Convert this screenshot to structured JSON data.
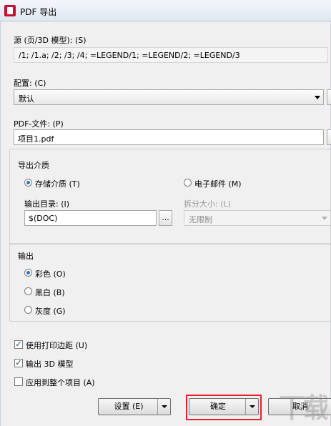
{
  "window": {
    "title": "PDF 导出"
  },
  "source": {
    "label": "源 (页/3D 模型): (S)",
    "value": "/1; /1.a; /2; /3; /4; =LEGEND/1; =LEGEND/2; =LEGEND/3"
  },
  "config": {
    "label": "配置: (C)",
    "value": "默认"
  },
  "pdf_file": {
    "label": "PDF-文件: (P)",
    "value": "项目1.pdf"
  },
  "export_media": {
    "title": "导出介质",
    "storage_label": "存储介质 (T)",
    "email_label": "电子邮件 (M)",
    "output_dir_label": "输出目录: (I)",
    "output_dir_value": "$(DOC)",
    "browse_label": "...",
    "split_label": "拆分大小: (L)",
    "split_value": "无限制"
  },
  "output": {
    "title": "输出",
    "color_label": "彩色 (O)",
    "bw_label": "黑白 (B)",
    "gray_label": "灰度 (G)"
  },
  "options": {
    "print_margin_label": "使用打印边距 (U)",
    "export_3d_label": "输出 3D 模型",
    "apply_project_label": "应用到整个项目 (A)"
  },
  "buttons": {
    "settings": "设置 (E)",
    "ok": "确定",
    "cancel": "取消"
  },
  "watermark": "下载吧",
  "colors": {
    "highlight": "#e8202a",
    "accent": "#2e6fc4"
  }
}
